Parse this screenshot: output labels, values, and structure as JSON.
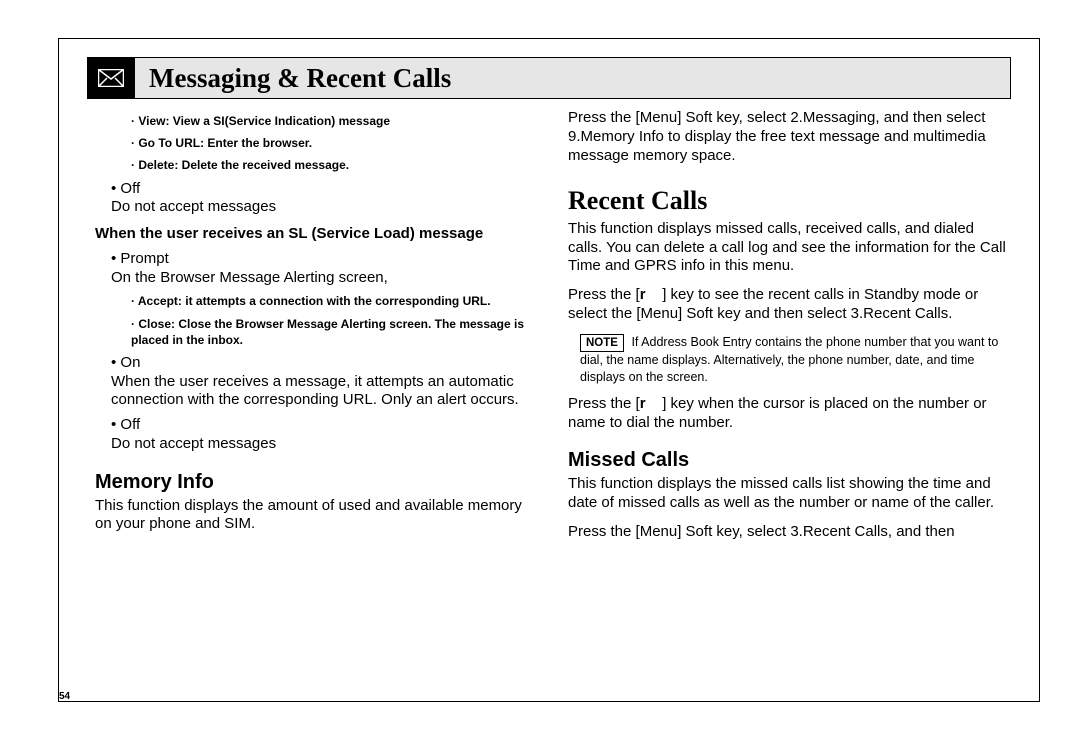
{
  "header": {
    "title": "Messaging & Recent Calls"
  },
  "left": {
    "sb1": "· View: View a SI(Service Indication) message",
    "sb2": "· Go To URL: Enter the browser.",
    "sb3": "· Delete: Delete the received message.",
    "mb_off1": "• Off",
    "mb_off1_body": "Do not accept messages",
    "bold1": "When the user receives an SL (Service Load) message",
    "mb_prompt": "• Prompt",
    "mb_prompt_body": "On the Browser Message Alerting screen,",
    "sb_accept": "· Accept: it attempts a connection with the corresponding URL.",
    "sb_close": "· Close: Close the Browser Message Alerting screen. The message is placed in the inbox.",
    "mb_on": "• On",
    "mb_on_body": "When the user receives a message, it attempts an automatic connection with the corresponding URL. Only an alert occurs.",
    "mb_off2": "• Off",
    "mb_off2_body": "Do not accept messages",
    "h2_mem": "Memory Info",
    "mem_body": "This function displays the amount of used and available memory on your phone and SIM."
  },
  "right": {
    "top_p": "Press the [Menu] Soft key, select 2.Messaging, and then select 9.Memory Info to display the free text message and multimedia message memory space.",
    "big_h": "Recent Calls",
    "rc_p1": "This function displays missed calls, received calls, and dialed calls. You can delete a call log and see the information for the Call Time and GPRS info in this menu.",
    "rc_p2a": "Press the [",
    "rc_p2_key": "r",
    "rc_p2b": "] key to see the recent calls in Standby mode or select the [Menu] Soft key and then select 3.Recent Calls.",
    "note_label": "NOTE",
    "note_body": "If Address Book Entry contains the phone number that you want to dial, the name displays. Alternatively, the phone number, date, and time displays on the screen.",
    "rc_p3a": "Press the [",
    "rc_p3_key": "r",
    "rc_p3b": "] key when the cursor is placed on the number or name to dial the number.",
    "h2_missed": "Missed Calls",
    "missed_p1": "This function displays the missed calls list showing the time and date of missed calls as well as the number or name of the caller.",
    "missed_p2": "Press the [Menu] Soft key, select 3.Recent Calls, and then"
  },
  "page_number": "54"
}
